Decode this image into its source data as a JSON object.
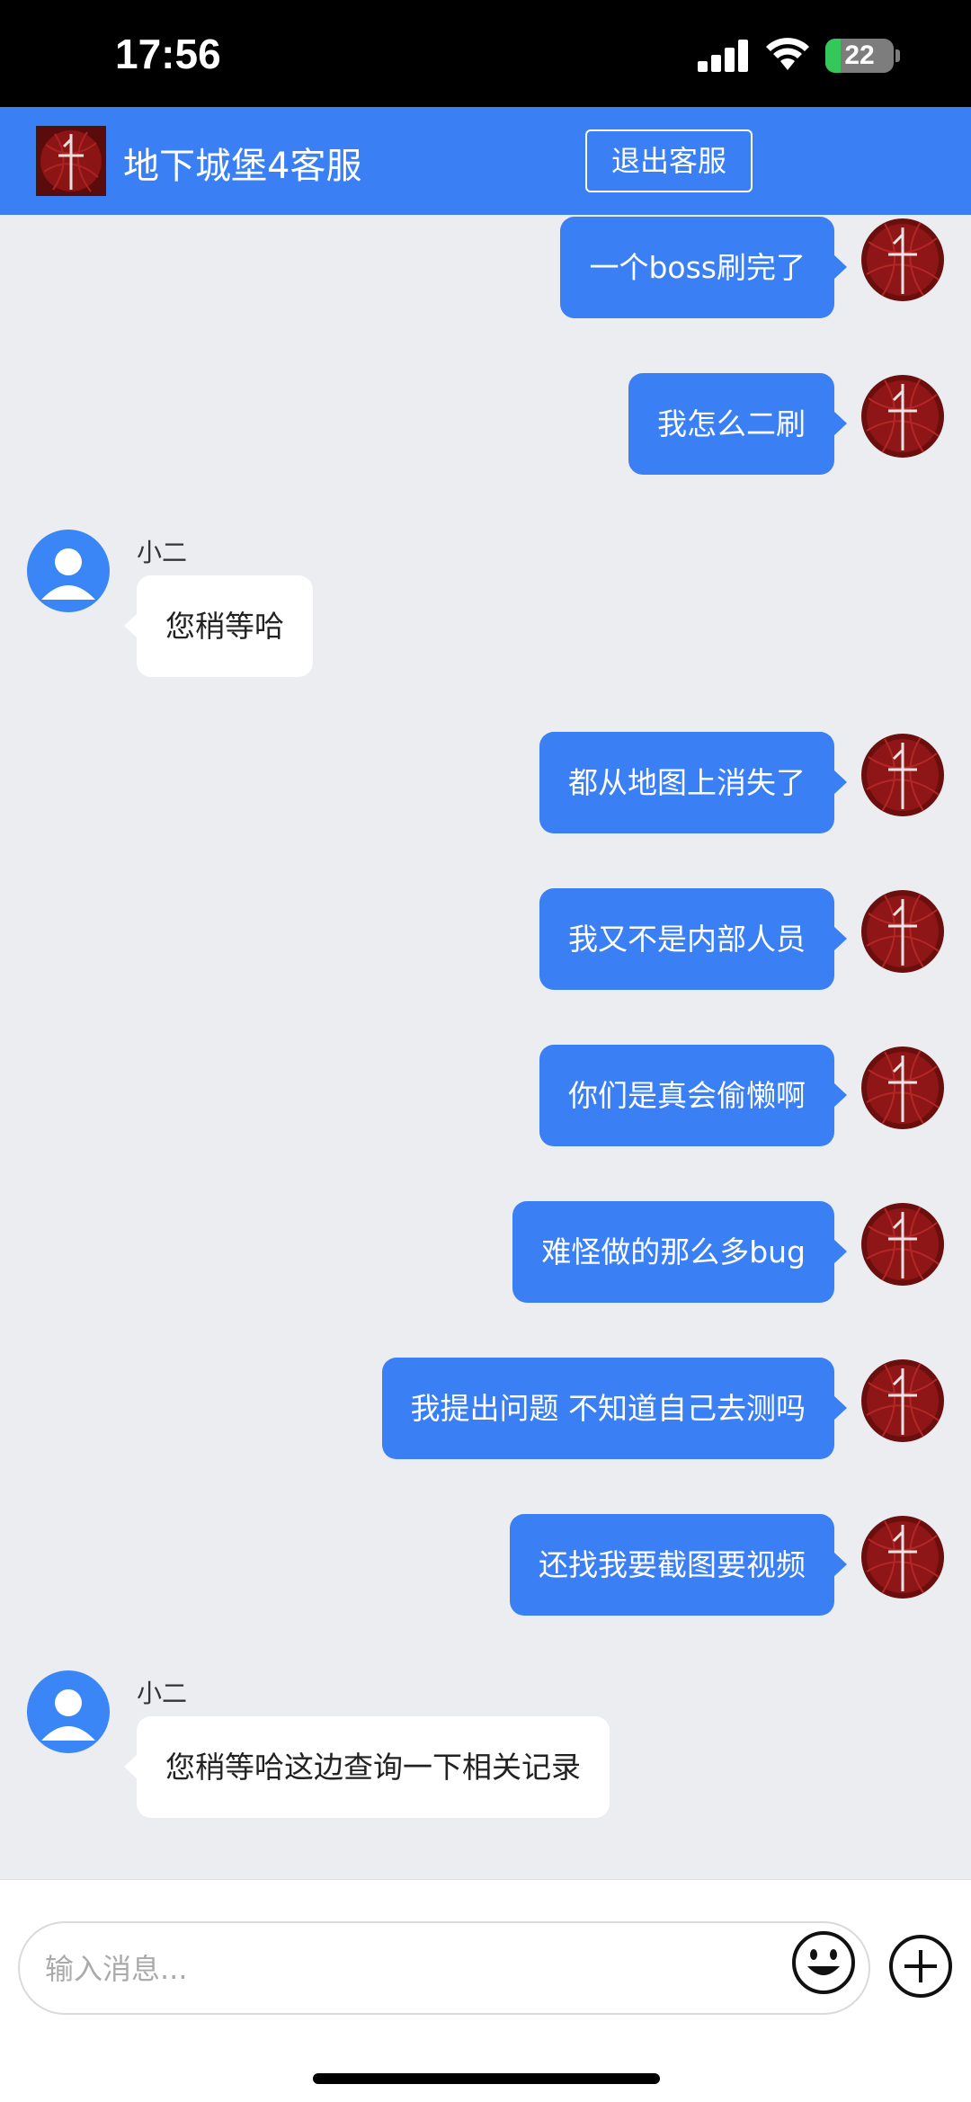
{
  "status_bar": {
    "time": "17:56",
    "battery": "22",
    "battery_level": 0.22
  },
  "header": {
    "title": "地下城堡4客服",
    "exit_label": "退出客服"
  },
  "agent_name": "小二",
  "messages": [
    {
      "side": "right",
      "text": "一个boss刷完了"
    },
    {
      "side": "right",
      "text": "我怎么二刷"
    },
    {
      "side": "left",
      "sender": "小二",
      "text": "您稍等哈"
    },
    {
      "side": "right",
      "text": "都从地图上消失了"
    },
    {
      "side": "right",
      "text": "我又不是内部人员"
    },
    {
      "side": "right",
      "text": "你们是真会偷懒啊"
    },
    {
      "side": "right",
      "text": "难怪做的那么多bug"
    },
    {
      "side": "right",
      "text": "我提出问题 不知道自己去测吗"
    },
    {
      "side": "right",
      "text": "还找我要截图要视频"
    },
    {
      "side": "left",
      "sender": "小二",
      "text": "您稍等哈这边查询一下相关记录"
    }
  ],
  "input": {
    "placeholder": "输入消息..."
  },
  "icons": {
    "emoji": "smiley-icon",
    "plus": "plus-circle-icon"
  },
  "colors": {
    "accent": "#3b7ff5",
    "background": "#ebedf0",
    "agent_avatar": "#3a86f7"
  }
}
